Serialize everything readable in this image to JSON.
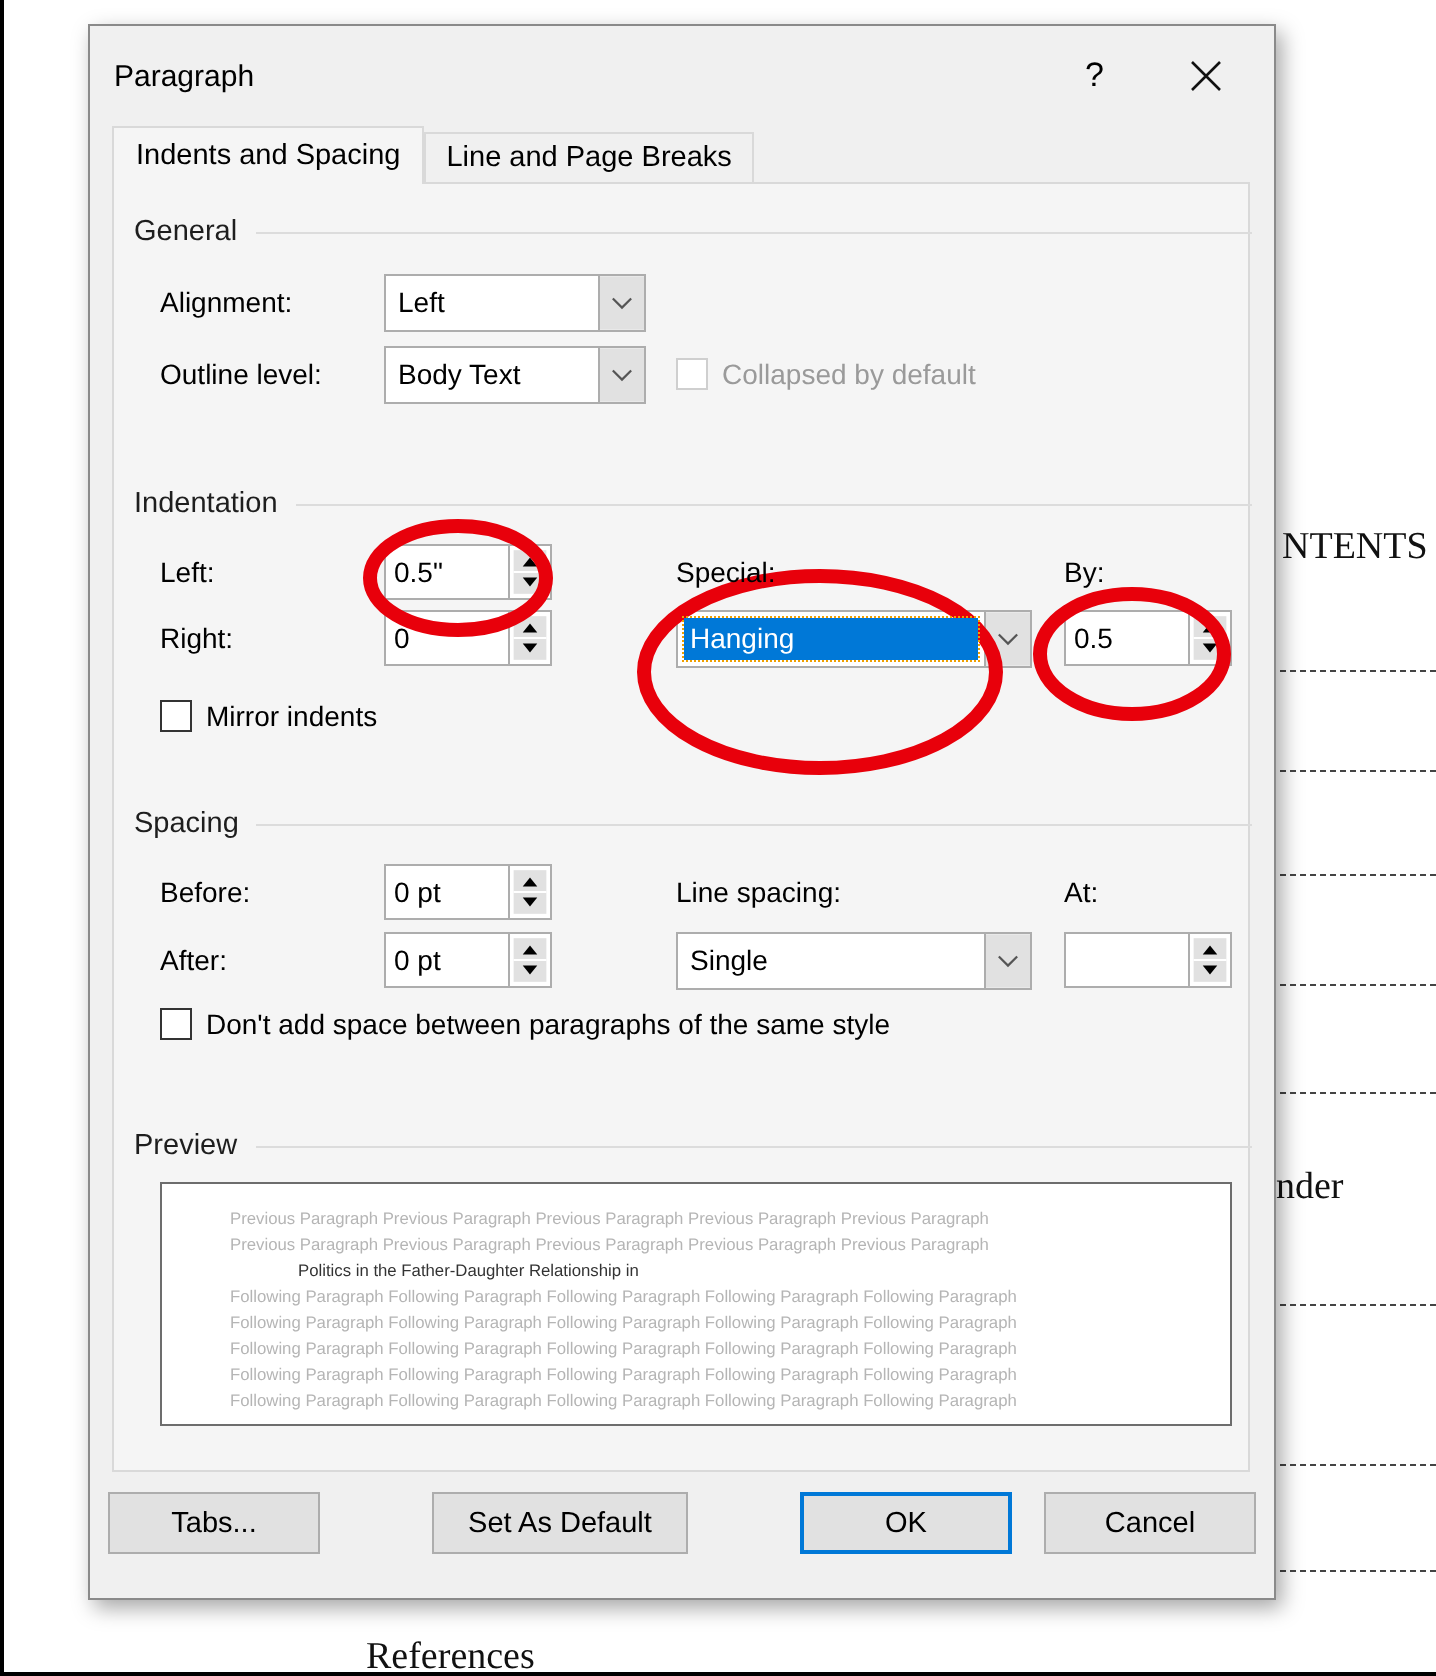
{
  "document": {
    "texts": [
      {
        "text": "NTENTS"
      },
      {
        "text": "nder"
      },
      {
        "text": "References"
      }
    ]
  },
  "dialog": {
    "title": "Paragraph",
    "help": "?"
  },
  "tabs": [
    {
      "label": "Indents and Spacing",
      "selected": true
    },
    {
      "label": "Line and Page Breaks",
      "selected": false
    }
  ],
  "general": {
    "title": "General",
    "alignment": {
      "label": "Alignment:",
      "value": "Left"
    },
    "outline_level": {
      "label": "Outline level:",
      "value": "Body Text"
    },
    "collapsed_by_default": {
      "label": "Collapsed by default",
      "checked": false,
      "disabled": true
    }
  },
  "indentation": {
    "title": "Indentation",
    "left": {
      "label": "Left:",
      "value": "0.5\""
    },
    "right": {
      "label": "Right:",
      "value": "0"
    },
    "special": {
      "label": "Special:",
      "value": "Hanging",
      "selected": true
    },
    "by": {
      "label": "By:",
      "value": "0.5"
    },
    "mirror_indents": {
      "label": "Mirror indents",
      "checked": false,
      "disabled": false
    }
  },
  "spacing": {
    "title": "Spacing",
    "before": {
      "label": "Before:",
      "value": "0 pt"
    },
    "after": {
      "label": "After:",
      "value": "0 pt"
    },
    "line_spacing": {
      "label": "Line spacing:",
      "value": "Single"
    },
    "at": {
      "label": "At:"
    },
    "dont_add_space": {
      "label": "Don't add space between paragraphs of the same style",
      "checked": false,
      "disabled": false
    }
  },
  "preview": {
    "title": "Preview",
    "previous_lines": [
      "Previous Paragraph Previous Paragraph Previous Paragraph Previous Paragraph Previous Paragraph",
      "Previous Paragraph Previous Paragraph Previous Paragraph Previous Paragraph Previous Paragraph"
    ],
    "current_lines": [
      "Politics in the Father-Daughter Relationship in"
    ],
    "following_lines": [
      "Following Paragraph Following Paragraph Following Paragraph Following Paragraph Following Paragraph",
      "Following Paragraph Following Paragraph Following Paragraph Following Paragraph Following Paragraph",
      "Following Paragraph Following Paragraph Following Paragraph Following Paragraph Following Paragraph",
      "Following Paragraph Following Paragraph Following Paragraph Following Paragraph Following Paragraph",
      "Following Paragraph Following Paragraph Following Paragraph Following Paragraph Following Paragraph"
    ]
  },
  "buttons": [
    {
      "label": "Tabs...",
      "default": false
    },
    {
      "label": "Set As Default",
      "default": false
    },
    {
      "label": "OK",
      "default": true
    },
    {
      "label": "Cancel",
      "default": false
    }
  ]
}
